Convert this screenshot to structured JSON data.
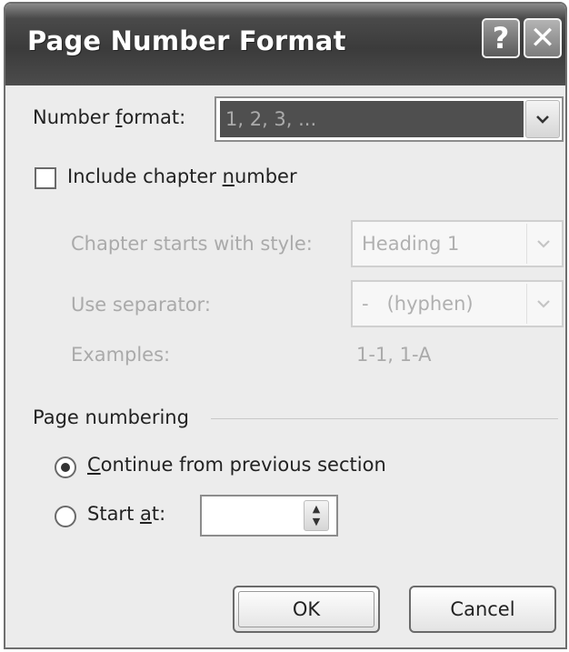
{
  "dialog": {
    "title": "Page Number Format",
    "help_glyph": "?",
    "close_glyph": "✕"
  },
  "number_format": {
    "label_pre": "Number ",
    "label_accel": "f",
    "label_post": "ormat:",
    "value": "1, 2, 3, ..."
  },
  "chapter": {
    "include_label_pre": "Include chapter ",
    "include_label_accel": "n",
    "include_label_post": "umber",
    "include_checked": false,
    "style_label": "Chapter starts with style:",
    "style_value": "Heading 1",
    "separator_label": "Use separator:",
    "separator_value": "-   (hyphen)",
    "examples_label": "Examples:",
    "examples_value": "1-1, 1-A"
  },
  "page_numbering": {
    "group_label": "Page numbering",
    "continue_accel": "C",
    "continue_rest": "ontinue from previous section",
    "start_pre": "Start ",
    "start_accel": "a",
    "start_post": "t:",
    "start_value": "",
    "selected": "continue"
  },
  "buttons": {
    "ok": "OK",
    "cancel": "Cancel"
  },
  "icons": {
    "dropdown": "chevron-down-icon",
    "spin_up": "▲",
    "spin_down": "▼",
    "chevron": "⌄"
  },
  "colors": {
    "titlebar": "#3b3b3b",
    "dialog_bg": "#ececec",
    "disabled_text": "#aaaaaa",
    "selection": "#4f4f4f"
  }
}
